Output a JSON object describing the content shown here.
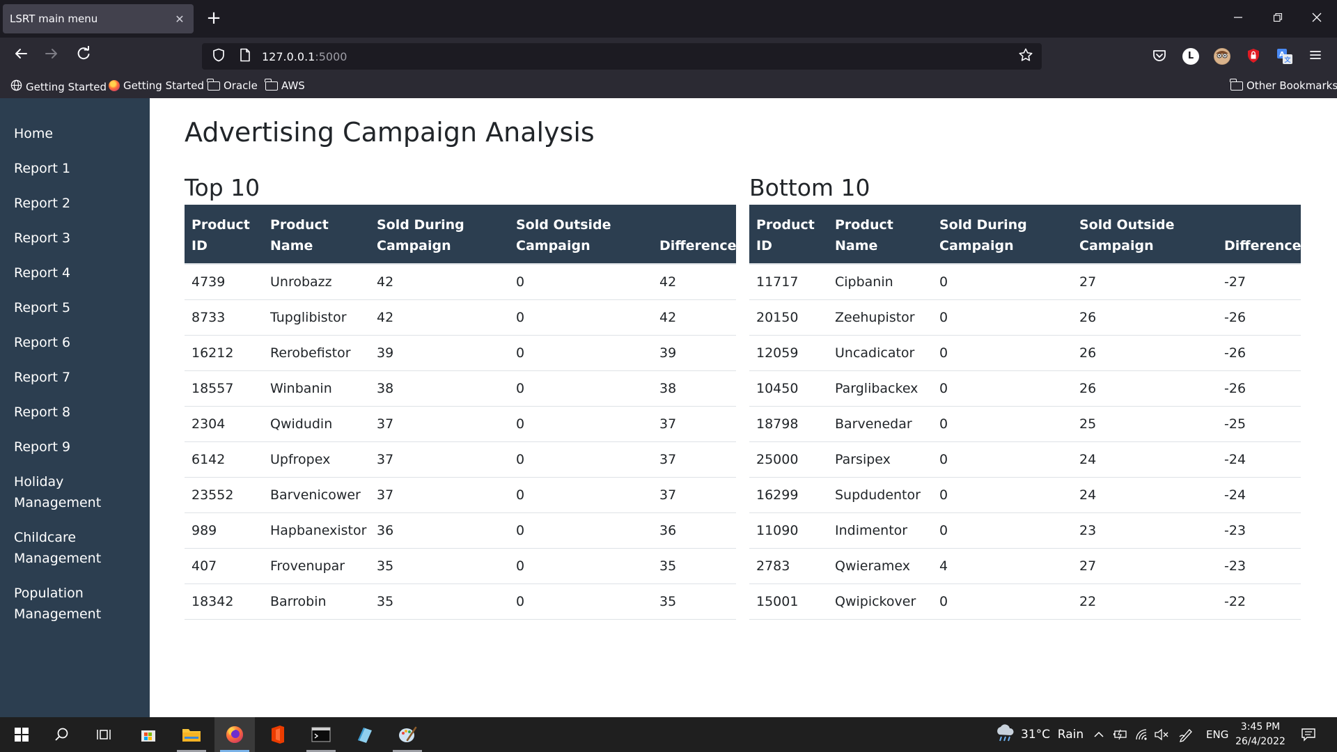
{
  "browser": {
    "tab_title": "LSRT main menu",
    "tab_close": "✕",
    "new_tab": "+",
    "url_host": "127.0.0.1",
    "url_port": ":5000",
    "bookmarks": [
      "Getting Started",
      "Getting Started",
      "Oracle",
      "AWS"
    ],
    "other_bookmarks": "Other Bookmarks",
    "extension_badge": "L"
  },
  "sidebar": {
    "items": [
      {
        "label": "Home"
      },
      {
        "label": "Report 1"
      },
      {
        "label": "Report 2"
      },
      {
        "label": "Report 3"
      },
      {
        "label": "Report 4"
      },
      {
        "label": "Report 5"
      },
      {
        "label": "Report 6"
      },
      {
        "label": "Report 7"
      },
      {
        "label": "Report 8"
      },
      {
        "label": "Report 9"
      },
      {
        "label": "Holiday\nManagement"
      },
      {
        "label": "Childcare\nManagement"
      },
      {
        "label": "Population\nManagement"
      }
    ]
  },
  "main": {
    "title": "Advertising Campaign Analysis",
    "headers": {
      "product_id": "Product\nID",
      "product_name": "Product\nName",
      "sold_during": "Sold During\nCampaign",
      "sold_outside": "Sold Outside\nCampaign",
      "difference": "Difference"
    },
    "top": {
      "heading": "Top 10",
      "rows": [
        [
          "4739",
          "Unrobazz",
          "42",
          "0",
          "42"
        ],
        [
          "8733",
          "Tupglibistor",
          "42",
          "0",
          "42"
        ],
        [
          "16212",
          "Rerobefistor",
          "39",
          "0",
          "39"
        ],
        [
          "18557",
          "Winbanin",
          "38",
          "0",
          "38"
        ],
        [
          "2304",
          "Qwidudin",
          "37",
          "0",
          "37"
        ],
        [
          "6142",
          "Upfropex",
          "37",
          "0",
          "37"
        ],
        [
          "23552",
          "Barvenicower",
          "37",
          "0",
          "37"
        ],
        [
          "989",
          "Hapbanexistor",
          "36",
          "0",
          "36"
        ],
        [
          "407",
          "Frovenupar",
          "35",
          "0",
          "35"
        ],
        [
          "18342",
          "Barrobin",
          "35",
          "0",
          "35"
        ]
      ]
    },
    "bottom": {
      "heading": "Bottom 10",
      "rows": [
        [
          "11717",
          "Cipbanin",
          "0",
          "27",
          "-27"
        ],
        [
          "20150",
          "Zeehupistor",
          "0",
          "26",
          "-26"
        ],
        [
          "12059",
          "Uncadicator",
          "0",
          "26",
          "-26"
        ],
        [
          "10450",
          "Parglibackex",
          "0",
          "26",
          "-26"
        ],
        [
          "18798",
          "Barvenedar",
          "0",
          "25",
          "-25"
        ],
        [
          "25000",
          "Parsipex",
          "0",
          "24",
          "-24"
        ],
        [
          "16299",
          "Supdudentor",
          "0",
          "24",
          "-24"
        ],
        [
          "11090",
          "Indimentor",
          "0",
          "23",
          "-23"
        ],
        [
          "2783",
          "Qwieramex",
          "4",
          "27",
          "-23"
        ],
        [
          "15001",
          "Qwipickover",
          "0",
          "22",
          "-22"
        ]
      ]
    }
  },
  "taskbar": {
    "weather": "31°C  Rain",
    "language": "ENG",
    "time": "3:45 PM",
    "date": "26/4/2022"
  },
  "colors": {
    "sidebar_bg": "#2c3e50",
    "header_bg": "#2c3e50",
    "browser_bg": "#2b2a33"
  }
}
